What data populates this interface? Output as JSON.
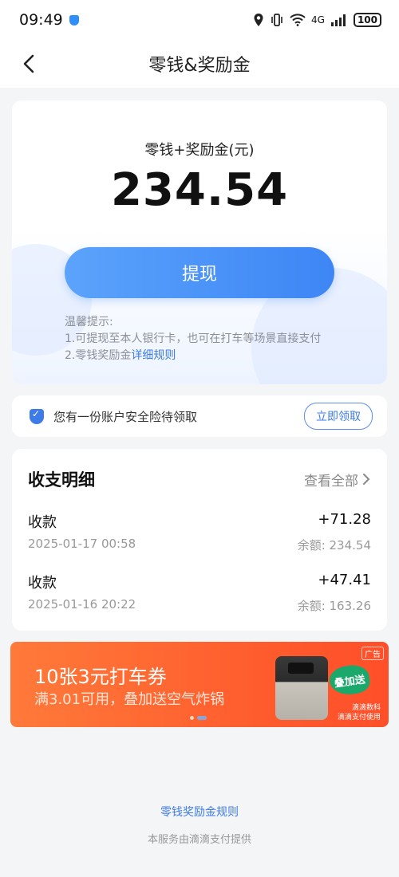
{
  "status_bar": {
    "time": "09:49",
    "network": "4G",
    "battery": "100"
  },
  "nav": {
    "title": "零钱&奖励金"
  },
  "balance": {
    "label": "零钱+奖励金(元)",
    "amount": "234.54",
    "withdraw_label": "提现",
    "tips_title": "温馨提示:",
    "tip1": "1.可提现至本人银行卡，也可在打车等场景直接支付",
    "tip2_prefix": "2.零钱奖励金",
    "tip2_link": "详细规则"
  },
  "insurance": {
    "text": "您有一份账户安全险待领取",
    "button": "立即领取"
  },
  "records": {
    "title": "收支明细",
    "view_all": "查看全部",
    "items": [
      {
        "type": "收款",
        "amount": "+71.28",
        "time": "2025-01-17 00:58",
        "balance": "余额: 234.54"
      },
      {
        "type": "收款",
        "amount": "+47.41",
        "time": "2025-01-16 20:22",
        "balance": "余额: 163.26"
      }
    ]
  },
  "ad": {
    "title": "10张3元打车券",
    "subtitle": "满3.01可用，叠加送空气炸锅",
    "badge": "叠加送",
    "tag": "广告",
    "brand": "滴滴数科",
    "brand_sub": "滴滴支付使用"
  },
  "footer": {
    "link": "零钱奖励金规则",
    "note": "本服务由滴滴支付提供"
  },
  "colors": {
    "accent": "#3d7be8",
    "button": "#4a93f8",
    "ad": "#ff5a2c"
  }
}
